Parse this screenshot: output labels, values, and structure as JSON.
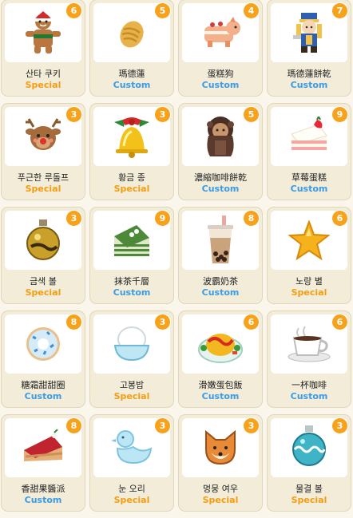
{
  "colors": {
    "badge": "#f7a21a",
    "special": "#f59d12",
    "custom": "#3b9be5"
  },
  "items": [
    {
      "name": "산타 쿠키",
      "tag": "Special",
      "count": "6",
      "icon": "santa-cookie"
    },
    {
      "name": "瑪德蓮",
      "tag": "Custom",
      "count": "5",
      "icon": "madeleine"
    },
    {
      "name": "蛋糕狗",
      "tag": "Custom",
      "count": "4",
      "icon": "cake-dog"
    },
    {
      "name": "瑪德蓮餅乾",
      "tag": "Custom",
      "count": "7",
      "icon": "madeleine-cookie"
    },
    {
      "name": "푸근한 루돌프",
      "tag": "Special",
      "count": "3",
      "icon": "reindeer"
    },
    {
      "name": "황금 종",
      "tag": "Special",
      "count": "3",
      "icon": "golden-bell"
    },
    {
      "name": "濃縮咖啡餅乾",
      "tag": "Custom",
      "count": "5",
      "icon": "espresso-cookie"
    },
    {
      "name": "草莓蛋糕",
      "tag": "Custom",
      "count": "9",
      "icon": "strawberry-cake"
    },
    {
      "name": "금색 볼",
      "tag": "Special",
      "count": "3",
      "icon": "gold-ornament"
    },
    {
      "name": "抹茶千層",
      "tag": "Custom",
      "count": "9",
      "icon": "matcha-crepe-cake"
    },
    {
      "name": "波霸奶茶",
      "tag": "Custom",
      "count": "8",
      "icon": "bubble-tea"
    },
    {
      "name": "노랑 별",
      "tag": "Special",
      "count": "6",
      "icon": "yellow-star"
    },
    {
      "name": "糖霜甜甜圈",
      "tag": "Custom",
      "count": "8",
      "icon": "frosted-donut"
    },
    {
      "name": "고봉밥",
      "tag": "Special",
      "count": "3",
      "icon": "rice-bowl"
    },
    {
      "name": "滑嫩蛋包飯",
      "tag": "Custom",
      "count": "6",
      "icon": "omurice"
    },
    {
      "name": "一杯咖啡",
      "tag": "Custom",
      "count": "6",
      "icon": "coffee-cup"
    },
    {
      "name": "香甜果醬派",
      "tag": "Custom",
      "count": "8",
      "icon": "jam-pie"
    },
    {
      "name": "눈 오리",
      "tag": "Special",
      "count": "3",
      "icon": "snow-duck"
    },
    {
      "name": "멍뭉 여우",
      "tag": "Special",
      "count": "3",
      "icon": "fox"
    },
    {
      "name": "물결 볼",
      "tag": "Special",
      "count": "3",
      "icon": "wave-ornament"
    }
  ]
}
